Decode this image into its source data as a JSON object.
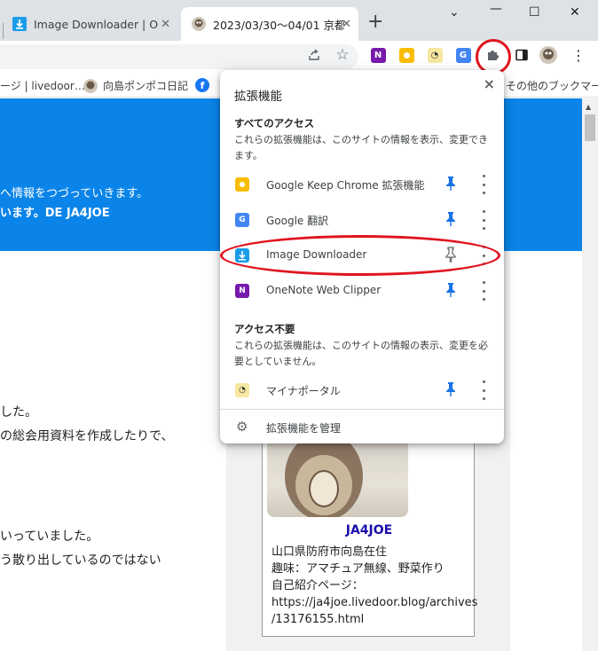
{
  "colors": {
    "accent": "#1a73e8",
    "hero_bg": "#0a84e8",
    "annotation": "#e0141e",
    "onenote": "#7719aa",
    "keep": "#fbbc04",
    "translate": "#4285f4",
    "downloader": "#1a9ce8"
  },
  "tabs": [
    {
      "title": "Image Downloader | Optio",
      "icon": "download-icon",
      "active": false
    },
    {
      "title": "2023/03/30～04/01 京都",
      "icon": "avatar-icon",
      "active": true
    }
  ],
  "bookmarks": [
    {
      "label": "ージ | livedoor…",
      "icon": "bookmark-page-icon"
    },
    {
      "label": "向島ポンポコ日記",
      "icon": "avatar-icon"
    },
    {
      "label": "",
      "icon": "facebook-icon"
    },
    {
      "label": "その他のブックマーク",
      "icon": "folder-icon"
    }
  ],
  "page": {
    "hero_line1": "へ情報をつづっていきます。",
    "hero_line2": "います。DE JA4JOE",
    "lines": [
      "した。",
      "の総会用資料を作成したりで、",
      "いっていました。",
      "う散り出しているのではない"
    ],
    "profile": {
      "name": "JA4JOE",
      "info": [
        "山口県防府市向島在住",
        "趣味：アマチュア無線、野菜作り",
        "自己紹介ページ：",
        "https://ja4joe.livedoor.blog/archives",
        "/13176155.html"
      ]
    }
  },
  "popup": {
    "title": "拡張機能",
    "close": "×",
    "all_access": {
      "heading": "すべてのアクセス",
      "description": "これらの拡張機能は、このサイトの情報を表示、変更できます。"
    },
    "extensions_access": [
      {
        "name": "Google Keep Chrome 拡張機能",
        "icon": "keep-icon",
        "pinned": true
      },
      {
        "name": "Google 翻訳",
        "icon": "translate-icon",
        "pinned": true
      },
      {
        "name": "Image Downloader",
        "icon": "download-icon",
        "pinned": false
      },
      {
        "name": "OneNote Web Clipper",
        "icon": "onenote-icon",
        "pinned": true
      }
    ],
    "no_access": {
      "heading": "アクセス不要",
      "description": "これらの拡張機能は、このサイトの情報の表示、変更を必要としていません。"
    },
    "extensions_no_access": [
      {
        "name": "マイナポータル",
        "icon": "myna-portal-icon",
        "pinned": true
      }
    ],
    "manage_label": "拡張機能を管理"
  }
}
